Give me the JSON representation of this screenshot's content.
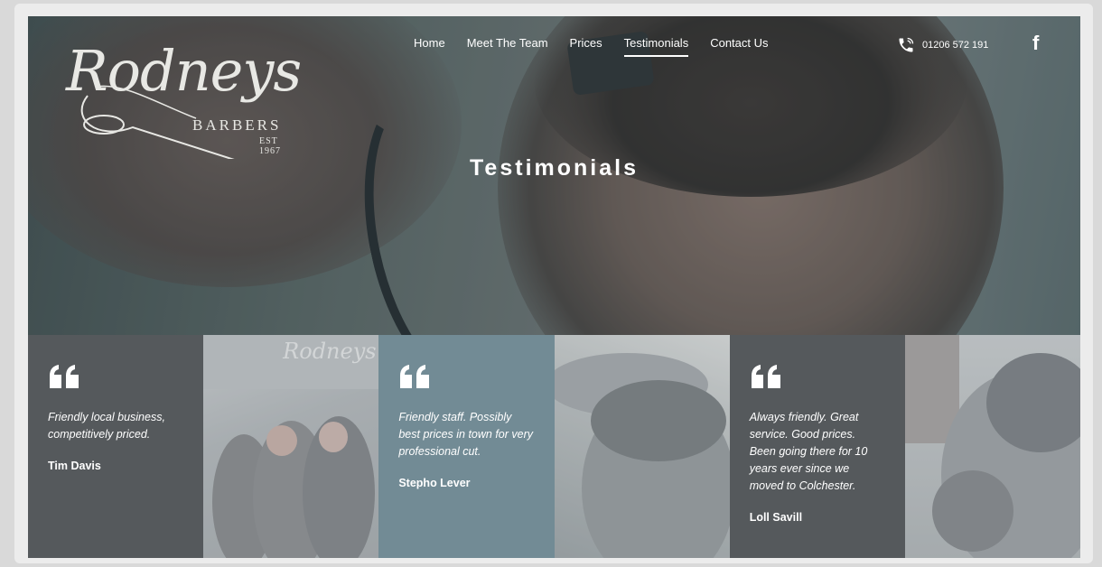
{
  "logo": {
    "script": "Rodneys",
    "barbers": "BARBERS",
    "est": "EST 1967"
  },
  "nav": {
    "items": [
      {
        "label": "Home"
      },
      {
        "label": "Meet The Team"
      },
      {
        "label": "Prices"
      },
      {
        "label": "Testimonials",
        "active": true
      },
      {
        "label": "Contact Us"
      }
    ]
  },
  "contact": {
    "phone": "01206 572 191",
    "phone_icon": "phone-icon",
    "social_icon": "facebook-icon",
    "social_glyph": "f"
  },
  "hero": {
    "title": "Testimonials"
  },
  "testimonials": [
    {
      "text": "Friendly local business, competitively priced.",
      "author": "Tim Davis"
    },
    {
      "text": "Friendly staff. Possibly best prices in town for very professional cut.",
      "author": "Stepho Lever"
    },
    {
      "text": "Always friendly. Great service. Good prices. Been going there for 10 years ever since we moved to Colchester.",
      "author": "Loll Savill"
    }
  ],
  "photo_tiles": [
    {
      "sign_text": "Rodneys"
    }
  ],
  "colors": {
    "dark_tile": "#55595c",
    "blue_tile": "#728b95",
    "text": "#ffffff"
  }
}
